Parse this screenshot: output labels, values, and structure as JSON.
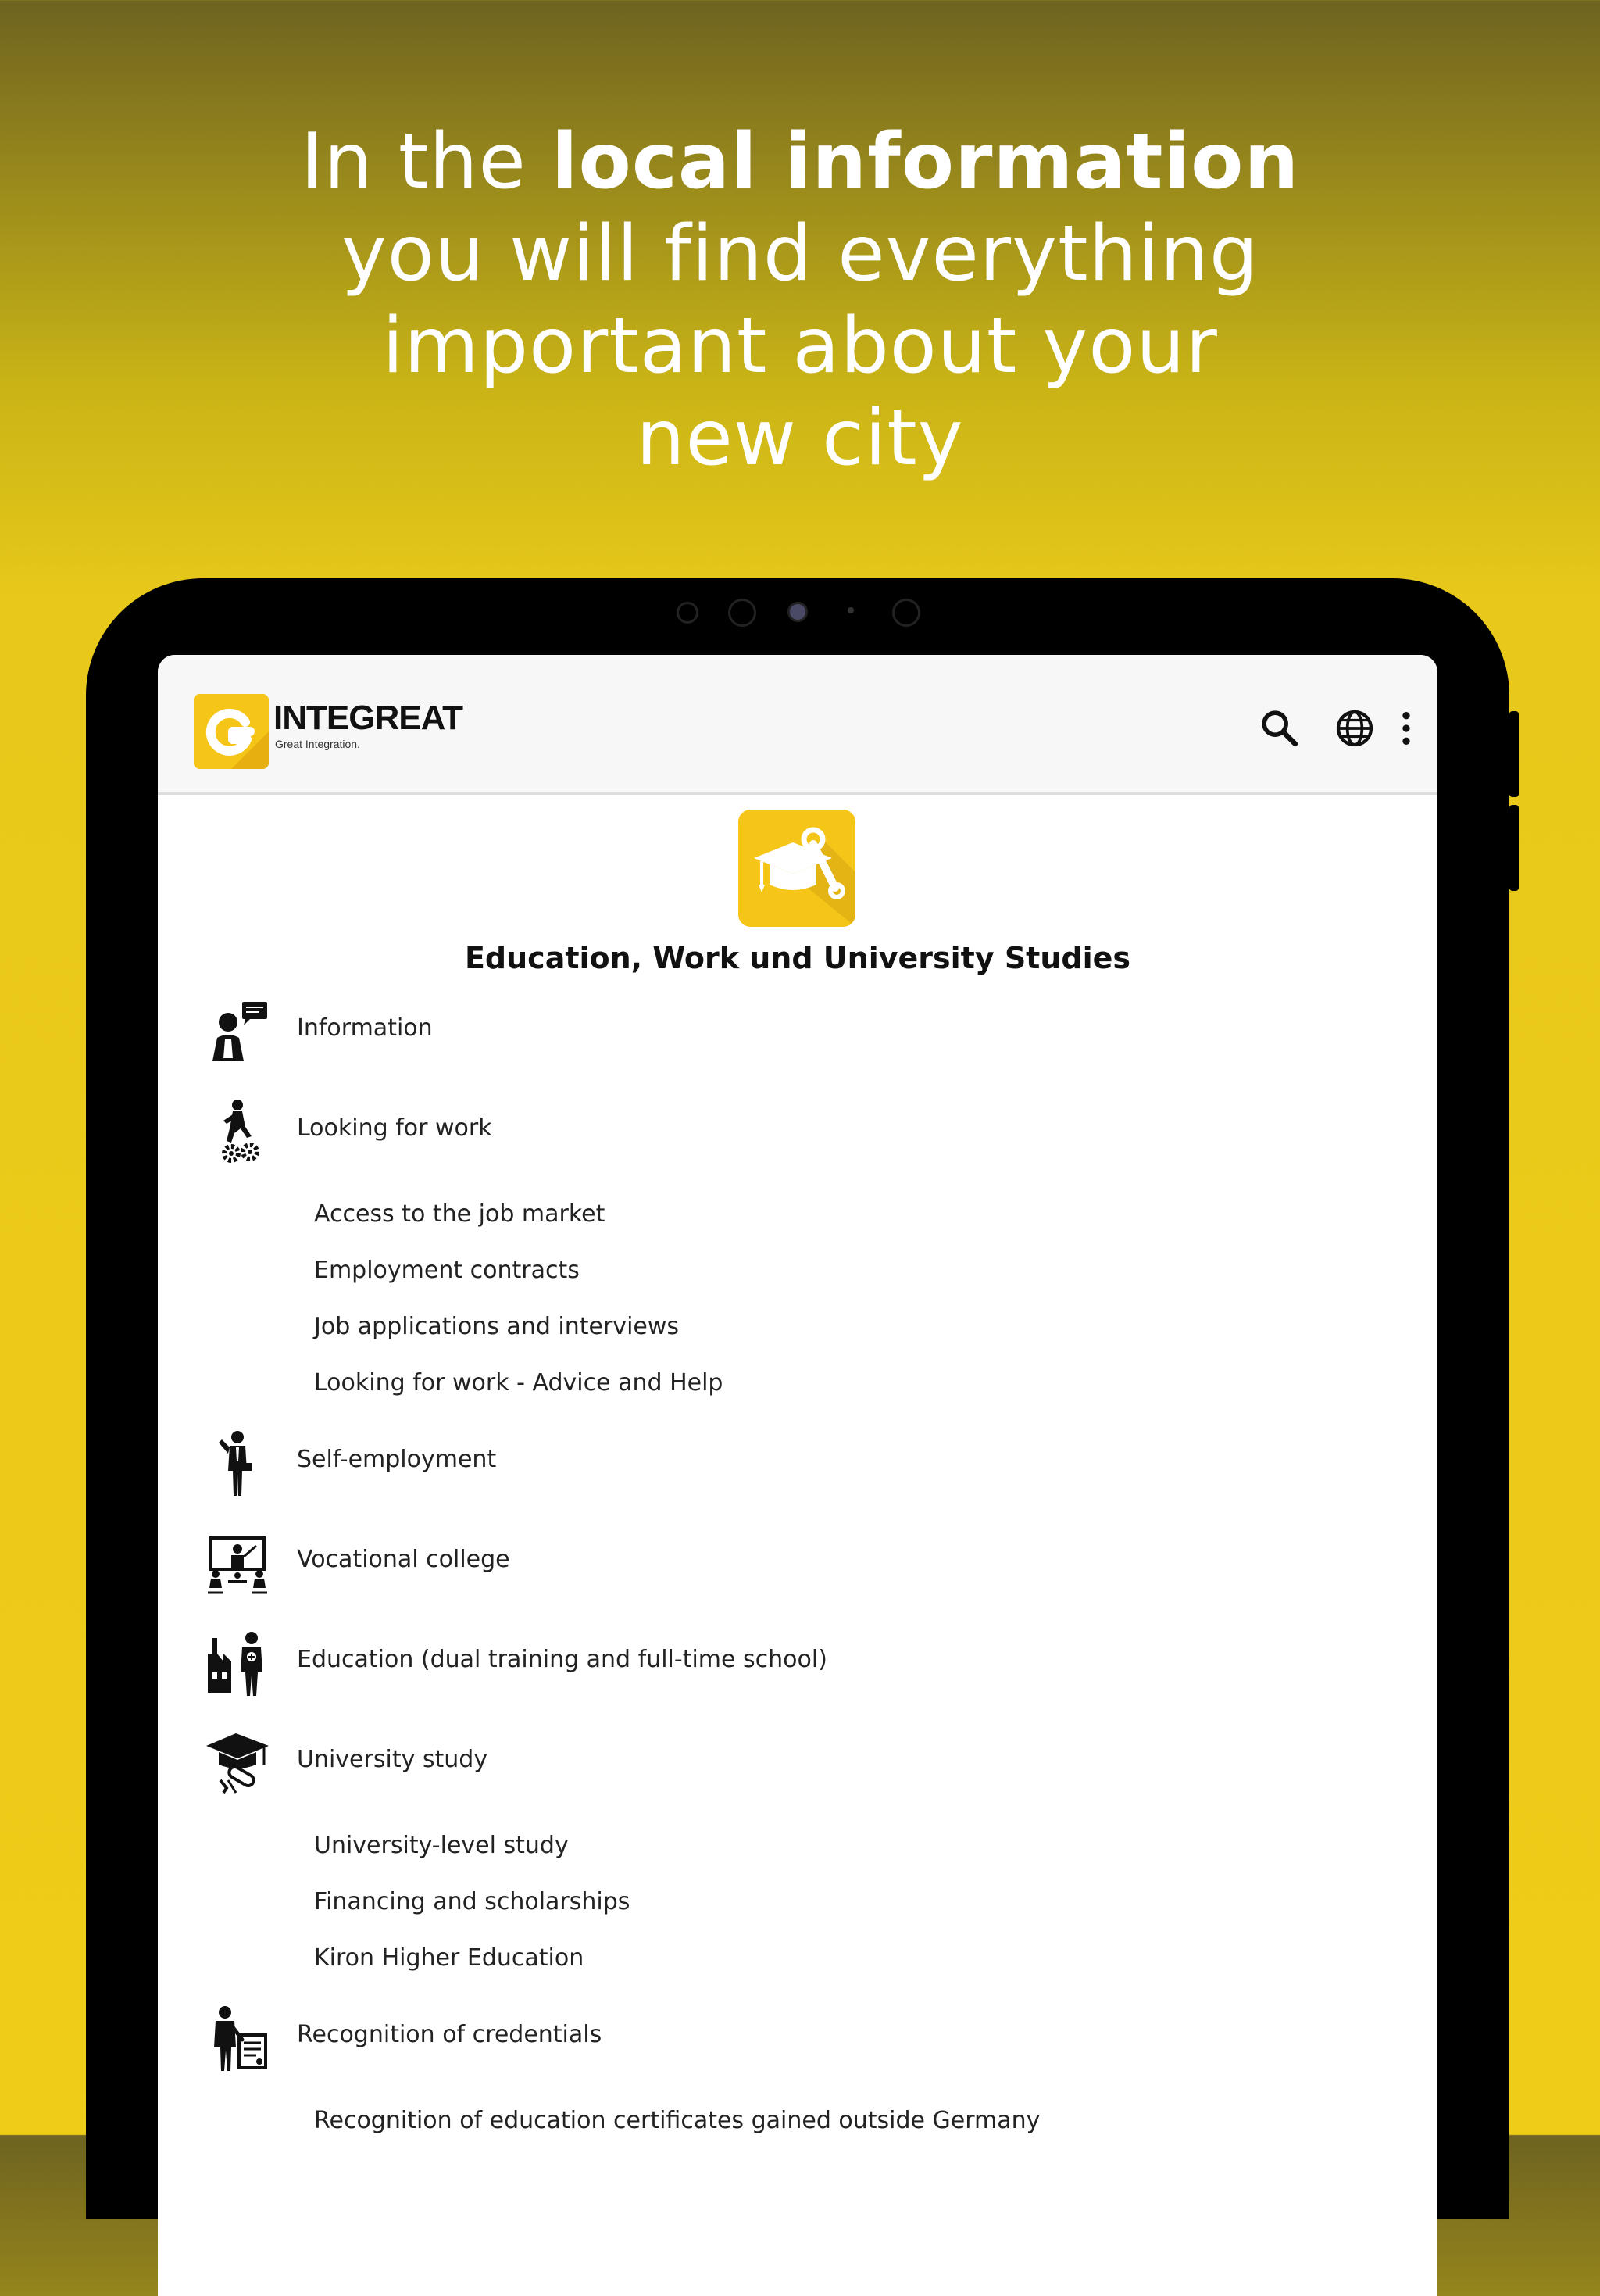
{
  "headline": {
    "line1_pre": "In the ",
    "line1_bold": "local information",
    "line2": "you will find everything",
    "line3": "important about your",
    "line4": "new city"
  },
  "app": {
    "brand_name": "INTEGREAT",
    "brand_tagline": "Great Integration.",
    "logo_letter": "G",
    "icons": [
      "search-icon",
      "globe-icon",
      "more-vert-icon"
    ]
  },
  "category": {
    "title": "Education, Work und University Studies",
    "icon": "graduation-cap-wrench-icon"
  },
  "entries": [
    {
      "label": "Information",
      "icon": "person-speech-bubble-icon"
    },
    {
      "label": "Looking for work",
      "icon": "person-climbing-gears-icon",
      "children": [
        "Access to the job market",
        "Employment contracts",
        "Job applications and interviews",
        "Looking for work - Advice and Help"
      ]
    },
    {
      "label": "Self-employment",
      "icon": "businessman-icon"
    },
    {
      "label": "Vocational college",
      "icon": "classroom-icon"
    },
    {
      "label": "Education (dual training and full-time school)",
      "icon": "factory-worker-icon"
    },
    {
      "label": "University study",
      "icon": "graduation-cap-diploma-icon",
      "children": [
        "University-level study",
        "Financing and scholarships",
        "Kiron Higher Education"
      ]
    },
    {
      "label": "Recognition of credentials",
      "icon": "person-certificate-icon",
      "children": [
        "Recognition of education certificates gained outside Germany"
      ]
    }
  ],
  "colors": {
    "brand_yellow": "#f5c518",
    "background_yellow": "#efcc18",
    "frame": "#000000"
  }
}
